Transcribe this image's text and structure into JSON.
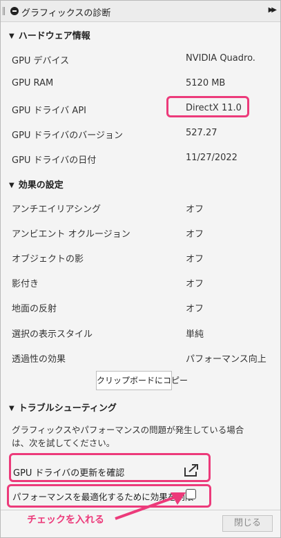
{
  "window": {
    "title": "グラフィックスの診断"
  },
  "hardware": {
    "header": "ハードウェア情報",
    "rows": [
      {
        "label": "GPU デバイス",
        "value": "NVIDIA Quadro..."
      },
      {
        "label": "GPU RAM",
        "value": "5120 MB"
      },
      {
        "label": "GPU ドライバ API",
        "value": "DirectX 11.0"
      },
      {
        "label": "GPU ドライバのバージョン",
        "value": "527.27"
      },
      {
        "label": "GPU ドライバの日付",
        "value": "11/27/2022"
      }
    ]
  },
  "effects": {
    "header": "効果の設定",
    "rows": [
      {
        "label": "アンチエイリアシング",
        "value": "オフ"
      },
      {
        "label": "アンビエント オクルージョン",
        "value": "オフ"
      },
      {
        "label": "オブジェクトの影",
        "value": "オフ"
      },
      {
        "label": "影付き",
        "value": "オフ"
      },
      {
        "label": "地面の反射",
        "value": "オフ"
      },
      {
        "label": "選択の表示スタイル",
        "value": "単純"
      },
      {
        "label": "透過性の効果",
        "value": "パフォーマンス向上"
      }
    ],
    "copy_button": "クリップボードにコピー"
  },
  "troubleshooting": {
    "header": "トラブルシューティング",
    "description": "グラフィックスやパフォーマンスの問題が発生している場合は、次を試してください。",
    "driver_update_link": "GPU ドライバの更新を確認",
    "optimize_checkbox_label": "パフォーマンスを最適化するために効果を制限",
    "optimize_checked": false
  },
  "footer": {
    "close_button": "閉じる"
  },
  "annotation": {
    "text": "チェックを入れる",
    "color": "#ec3a7a"
  }
}
